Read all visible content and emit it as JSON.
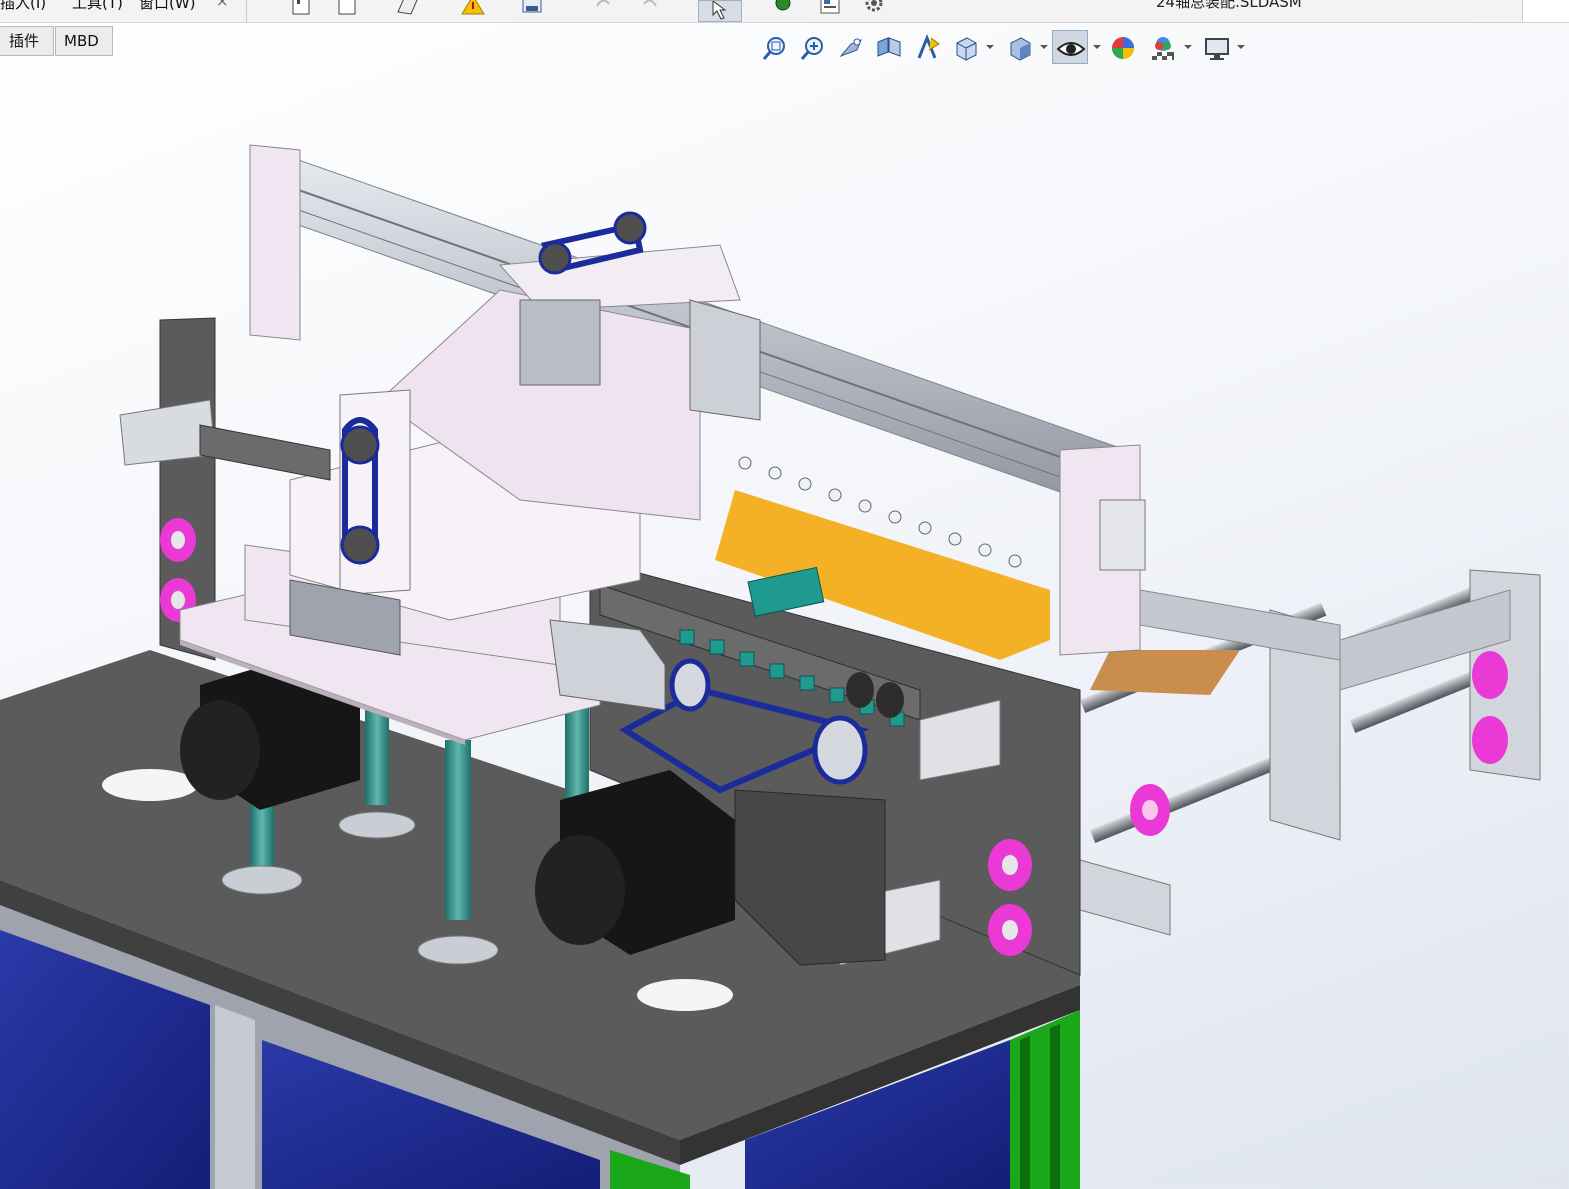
{
  "menubar": {
    "items": [
      "插入(I)",
      "工具(T)",
      "窗口(W)"
    ],
    "close_glyph": "×",
    "document_title": "24轴总装配.SLDASM"
  },
  "command_tabs": [
    "插件",
    "MBD"
  ],
  "heads_up_toolbar": {
    "icons": [
      "zoom-to-fit-icon",
      "zoom-to-area-icon",
      "previous-view-icon",
      "section-view-icon",
      "dynamic-annotation-view-icon",
      "view-orientation-icon",
      "display-style-icon",
      "hide-show-items-icon",
      "edit-appearance-icon",
      "apply-scene-icon",
      "view-settings-icon"
    ],
    "active_icon": "hide-show-items-icon"
  },
  "model": {
    "part_colors": {
      "frame_plate": "#5b5b5b",
      "cabinet_panel": "#1f2c8f",
      "aluminum_profile": "#cfd3da",
      "bracket": "#f0e6f2",
      "motor": "#161616",
      "belt": "#1b2b9a",
      "accent_magenta": "#ea39d4",
      "accent_teal": "#1f9a8f",
      "accent_orange": "#f4b126",
      "extrusion_green": "#1aa81a"
    }
  }
}
